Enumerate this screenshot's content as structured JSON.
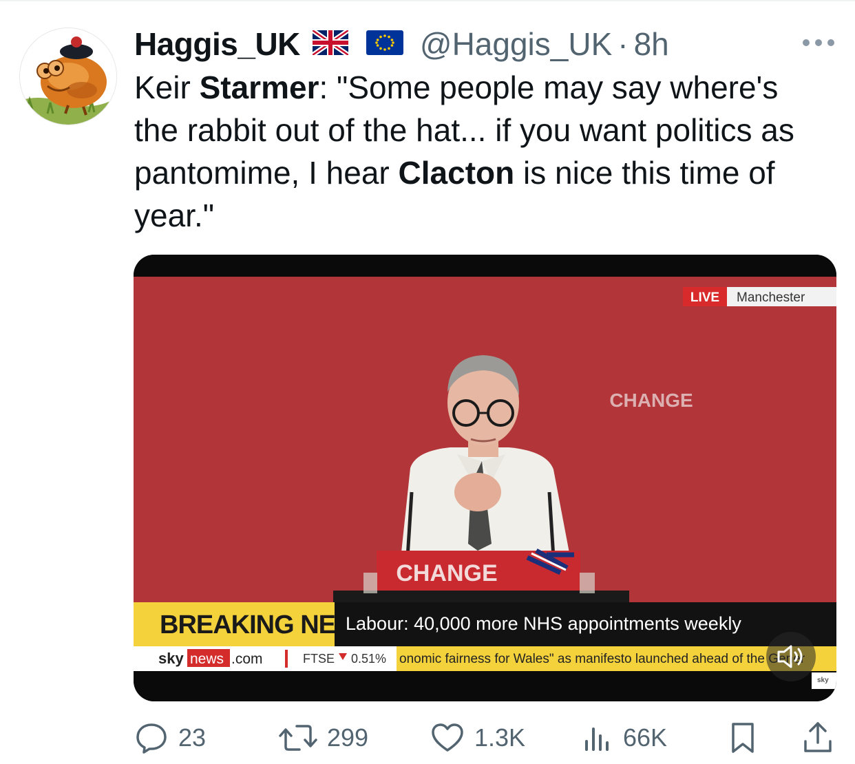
{
  "tweet": {
    "author": {
      "display_name": "Haggis_UK",
      "flags": [
        "uk-flag-icon",
        "eu-flag-icon"
      ],
      "handle": "@Haggis_UK",
      "separator": "·",
      "time": "8h"
    },
    "text": {
      "p1": "Keir ",
      "b1": "Starmer",
      "p2": ": \"Some people may say where's the rabbit out of the hat... if you want politics as pantomime, I hear ",
      "b2": "Clacton",
      "p3": " is nice this time of year.\""
    }
  },
  "video": {
    "live_badge": "LIVE",
    "location": "Manchester",
    "backdrop_text": "CHANGE",
    "podium_text": "CHANGE",
    "breaking_label": "BREAKING NEWS",
    "headline": "Labour: 40,000 more NHS appointments weekly",
    "brand_sky": "sky",
    "brand_news": "news",
    "brand_com": ".com",
    "ftse_label": "FTSE",
    "ftse_change": "0.51%",
    "ticker": "onomic fairness for Wales\" as manifesto launched ahead of the Gener",
    "mute_icon": "speaker-muted-icon",
    "corner_logo": "sky"
  },
  "actions": {
    "replies": "23",
    "retweets": "299",
    "likes": "1.3K",
    "views": "66K"
  },
  "colors": {
    "text": "#0f1419",
    "secondary": "#536471",
    "backdrop_red": "#b9383c",
    "breaking_yellow": "#f4d23c"
  }
}
